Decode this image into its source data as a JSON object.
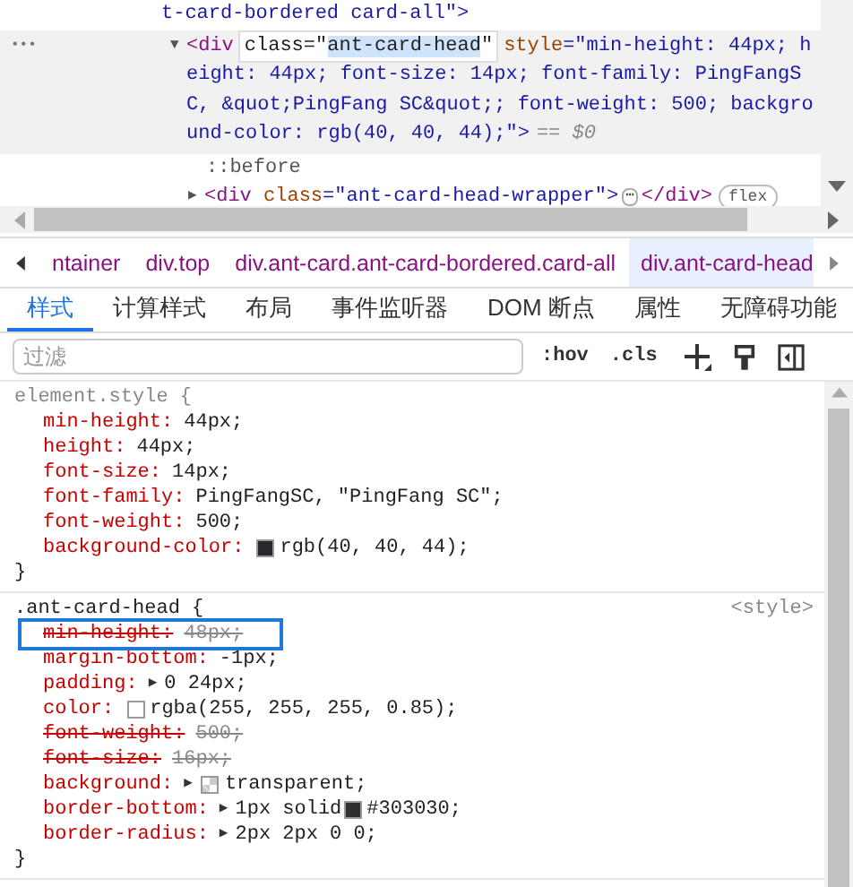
{
  "dom_tree": {
    "lines": [
      {
        "kind": "text",
        "text": "t-card-bordered card-all\">"
      },
      {
        "kind": "selected",
        "toggle": "▼",
        "open_tag": "<div",
        "editor": {
          "before": "class=\"",
          "selected_text": "ant-card-head",
          "after": "\""
        },
        "rest_first": {
          "attr": "style",
          "value": "=\"min-height: 44px; h"
        },
        "rest_lines": [
          "eight: 44px; font-size: 14px; font-family: PingFangS",
          "C, &quot;PingFang SC&quot;; font-weight: 500; backgro",
          "und-color: rgb(40, 40, 44);\">"
        ],
        "marker": "== $0",
        "menu": "•••"
      },
      {
        "kind": "pseudo",
        "text": "::before"
      },
      {
        "kind": "collapsed",
        "toggle": "▶",
        "open_tag": "<div",
        "attr": "class",
        "value": "=\"ant-card-head-wrapper\">",
        "ellipsis": "⋯",
        "close": "</div>",
        "badge": "flex"
      }
    ]
  },
  "breadcrumbs": [
    {
      "label": "ntainer",
      "selected": false
    },
    {
      "label": "div.top",
      "selected": false
    },
    {
      "label": "div.ant-card.ant-card-bordered.card-all",
      "selected": false
    },
    {
      "label": "div.ant-card-head",
      "selected": true
    }
  ],
  "tabs": [
    {
      "label": "样式",
      "selected": true
    },
    {
      "label": "计算样式",
      "selected": false
    },
    {
      "label": "布局",
      "selected": false
    },
    {
      "label": "事件监听器",
      "selected": false
    },
    {
      "label": "DOM 断点",
      "selected": false
    },
    {
      "label": "属性",
      "selected": false
    },
    {
      "label": "无障碍功能",
      "selected": false
    }
  ],
  "filter": {
    "placeholder": "过滤",
    "buttons": [
      ":hov",
      ".cls"
    ]
  },
  "rules": [
    {
      "selector": "element.style {",
      "selector_dim": true,
      "close": "}",
      "declarations": [
        {
          "name": "min-height:",
          "value": "44px;",
          "overridden": false,
          "highlighted": false
        },
        {
          "name": "height:",
          "value": "44px;",
          "overridden": false,
          "highlighted": false
        },
        {
          "name": "font-size:",
          "value": "14px;",
          "overridden": false,
          "highlighted": false
        },
        {
          "name": "font-family:",
          "value": "PingFangSC, \"PingFang SC\";",
          "overridden": false,
          "highlighted": false
        },
        {
          "name": "font-weight:",
          "value": "500;",
          "overridden": false,
          "highlighted": false
        },
        {
          "name": "background-color:",
          "value": "rgb(40, 40, 44);",
          "overridden": false,
          "highlighted": false,
          "swatch": {
            "kind": "color",
            "color": "#28282c"
          }
        }
      ]
    },
    {
      "selector": ".ant-card-head {",
      "selector_dim": false,
      "source": "<style>",
      "close": "}",
      "declarations": [
        {
          "name": "min-height:",
          "value": "48px;",
          "overridden": true,
          "highlighted": true
        },
        {
          "name": "margin-bottom:",
          "value": "-1px;",
          "overridden": false,
          "highlighted": false
        },
        {
          "name": "padding:",
          "toggle": "▶",
          "value": "0 24px;",
          "overridden": false,
          "highlighted": false
        },
        {
          "name": "color:",
          "value": "rgba(255, 255, 255, 0.85);",
          "overridden": false,
          "highlighted": false,
          "swatch": {
            "kind": "color",
            "color": "#ffffff"
          }
        },
        {
          "name": "font-weight:",
          "value": "500;",
          "overridden": true,
          "highlighted": false
        },
        {
          "name": "font-size:",
          "value": "16px;",
          "overridden": true,
          "highlighted": false
        },
        {
          "name": "background:",
          "toggle": "▶",
          "value": "transparent;",
          "overridden": false,
          "highlighted": false,
          "swatch": {
            "kind": "checker"
          }
        },
        {
          "name": "border-bottom:",
          "toggle": "▶",
          "value": "1px solid",
          "value2": "#303030;",
          "overridden": false,
          "highlighted": false,
          "swatch": {
            "kind": "color",
            "color": "#303030"
          }
        },
        {
          "name": "border-radius:",
          "toggle": "▶",
          "value": "2px 2px 0 0;",
          "overridden": false,
          "highlighted": false
        }
      ]
    }
  ]
}
